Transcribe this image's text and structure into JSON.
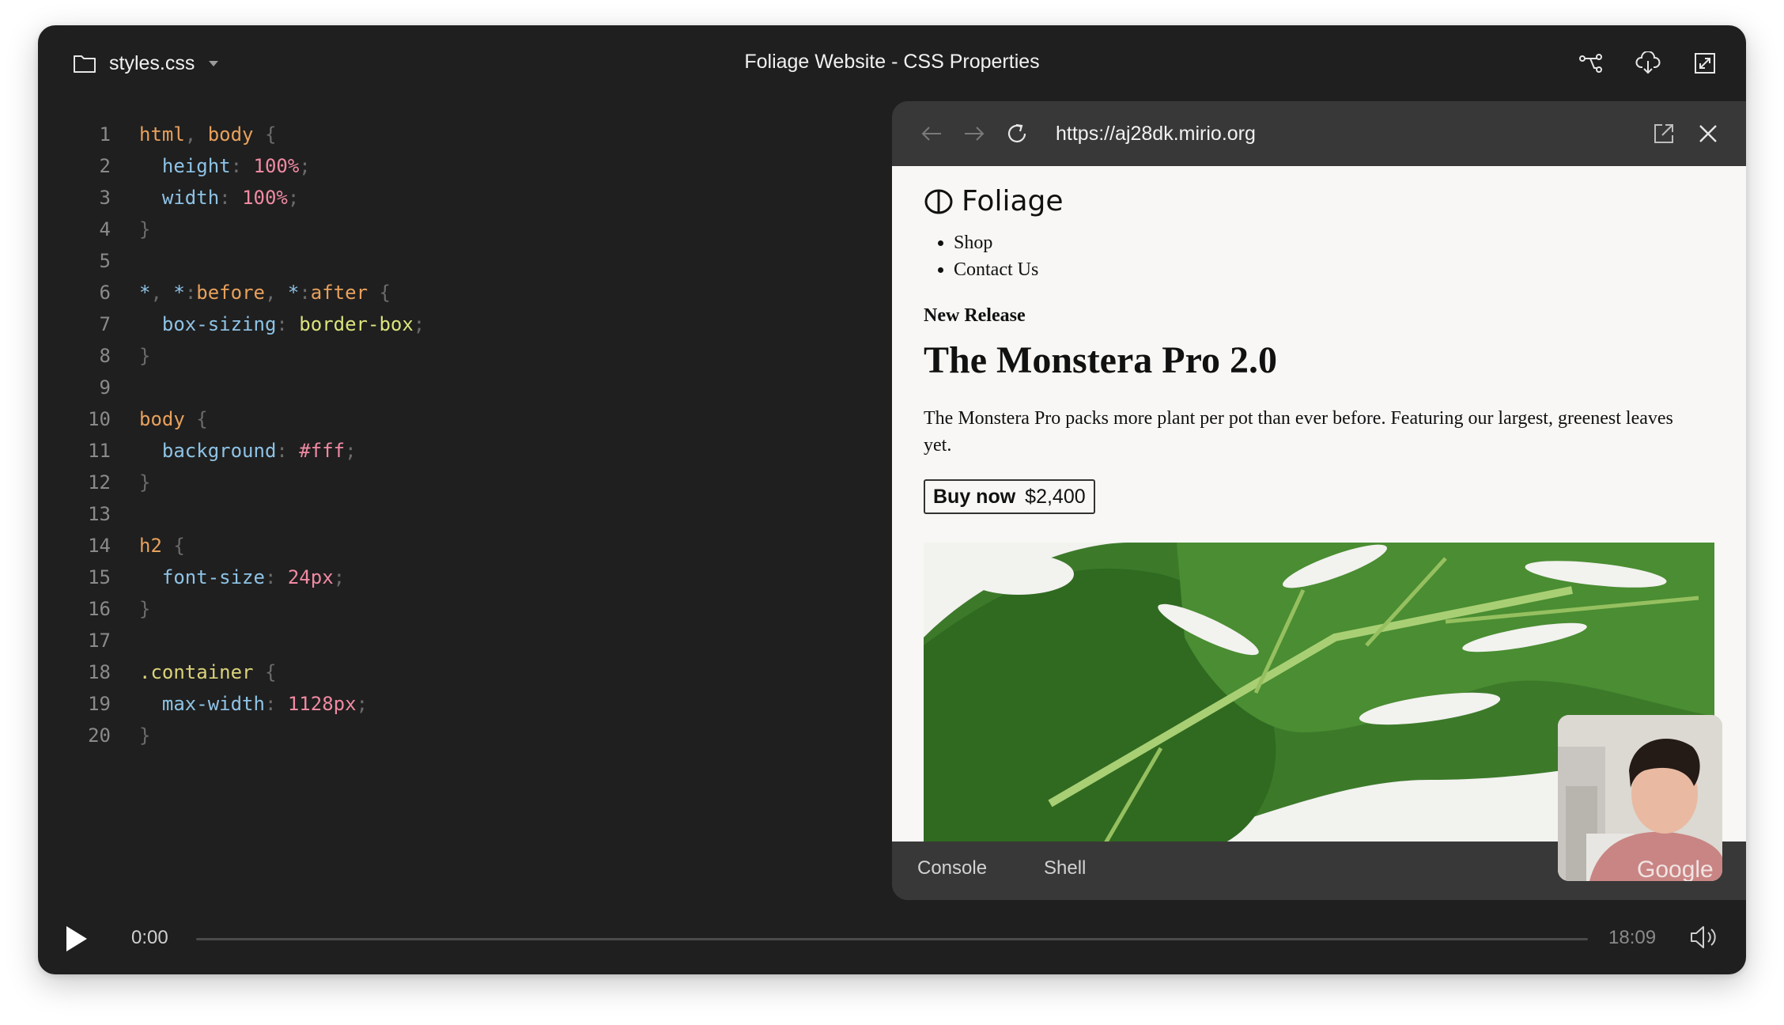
{
  "header": {
    "file_name": "styles.css",
    "title": "Foliage Website - CSS Properties"
  },
  "icons": {
    "folder": "folder-icon",
    "dropdown": "chevron-down-icon",
    "share": "share-nodes-icon",
    "download": "cloud-download-icon",
    "expand": "expand-icon",
    "back": "arrow-left-icon",
    "forward": "arrow-right-icon",
    "reload": "reload-icon",
    "open_external": "external-link-icon",
    "close": "close-icon",
    "play": "play-icon",
    "volume": "volume-icon"
  },
  "editor": {
    "lines": [
      {
        "n": "1",
        "tokens": [
          [
            "sel",
            "html"
          ],
          [
            "pun",
            ", "
          ],
          [
            "sel",
            "body"
          ],
          [
            "pun",
            " {"
          ]
        ]
      },
      {
        "n": "2",
        "tokens": [
          [
            "prop",
            "  height"
          ],
          [
            "pun",
            ": "
          ],
          [
            "num",
            "100%"
          ],
          [
            "pun",
            ";"
          ]
        ]
      },
      {
        "n": "3",
        "tokens": [
          [
            "prop",
            "  width"
          ],
          [
            "pun",
            ": "
          ],
          [
            "num",
            "100%"
          ],
          [
            "pun",
            ";"
          ]
        ]
      },
      {
        "n": "4",
        "tokens": [
          [
            "pun",
            "}"
          ]
        ]
      },
      {
        "n": "5",
        "tokens": []
      },
      {
        "n": "6",
        "tokens": [
          [
            "star",
            "*"
          ],
          [
            "pun",
            ", "
          ],
          [
            "star",
            "*"
          ],
          [
            "pun",
            ":"
          ],
          [
            "sel",
            "before"
          ],
          [
            "pun",
            ", "
          ],
          [
            "star",
            "*"
          ],
          [
            "pun",
            ":"
          ],
          [
            "sel",
            "after"
          ],
          [
            "pun",
            " {"
          ]
        ]
      },
      {
        "n": "7",
        "tokens": [
          [
            "prop",
            "  box-sizing"
          ],
          [
            "pun",
            ": "
          ],
          [
            "val",
            "border-box"
          ],
          [
            "pun",
            ";"
          ]
        ]
      },
      {
        "n": "8",
        "tokens": [
          [
            "pun",
            "}"
          ]
        ]
      },
      {
        "n": "9",
        "tokens": []
      },
      {
        "n": "10",
        "tokens": [
          [
            "sel",
            "body"
          ],
          [
            "pun",
            " {"
          ]
        ]
      },
      {
        "n": "11",
        "tokens": [
          [
            "prop",
            "  background"
          ],
          [
            "pun",
            ": "
          ],
          [
            "num",
            "#fff"
          ],
          [
            "pun",
            ";"
          ]
        ]
      },
      {
        "n": "12",
        "tokens": [
          [
            "pun",
            "}"
          ]
        ]
      },
      {
        "n": "13",
        "tokens": []
      },
      {
        "n": "14",
        "tokens": [
          [
            "sel",
            "h2"
          ],
          [
            "pun",
            " {"
          ]
        ]
      },
      {
        "n": "15",
        "tokens": [
          [
            "prop",
            "  font-size"
          ],
          [
            "pun",
            ": "
          ],
          [
            "num",
            "24px"
          ],
          [
            "pun",
            ";"
          ]
        ]
      },
      {
        "n": "16",
        "tokens": [
          [
            "pun",
            "}"
          ]
        ]
      },
      {
        "n": "17",
        "tokens": []
      },
      {
        "n": "18",
        "tokens": [
          [
            "selc",
            ".container"
          ],
          [
            "pun",
            " {"
          ]
        ]
      },
      {
        "n": "19",
        "tokens": [
          [
            "prop",
            "  max-width"
          ],
          [
            "pun",
            ": "
          ],
          [
            "num",
            "1128px"
          ],
          [
            "pun",
            ";"
          ]
        ]
      },
      {
        "n": "20",
        "tokens": [
          [
            "pun",
            "}"
          ]
        ]
      }
    ]
  },
  "browser": {
    "url": "https://aj28dk.mirio.org",
    "site": {
      "logo_text": "Foliage",
      "nav": [
        "Shop",
        "Contact Us"
      ],
      "eyebrow": "New Release",
      "headline": "The Monstera Pro 2.0",
      "description": "The Monstera Pro packs more plant per pot than ever before. Featuring our largest, greenest leaves yet.",
      "buy_label": "Buy now",
      "price": "$2,400"
    },
    "tabs": [
      "Console",
      "Shell"
    ],
    "pip_shirt_text": "Google"
  },
  "player": {
    "current_time": "0:00",
    "total_time": "18:09",
    "progress": 0
  },
  "colors": {
    "window_bg": "#1f1f1f",
    "panel_bg": "#383838",
    "page_bg": "#f8f7f5",
    "leaf_green": "#3f7f2a"
  }
}
